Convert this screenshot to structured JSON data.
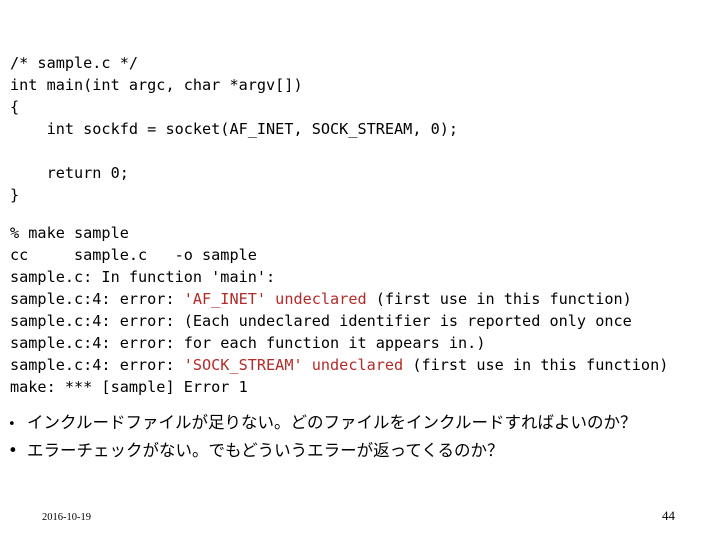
{
  "slide": {
    "background_color": "#ffffff",
    "error_color": "#b32b28",
    "text_color": "#000000"
  },
  "source_code": {
    "language": "c",
    "filename": "sample.c",
    "lines": [
      "/* sample.c */",
      "int main(int argc, char *argv[])",
      "{",
      "    int sockfd = socket(AF_INET, SOCK_STREAM, 0);",
      "",
      "    return 0;",
      "}"
    ]
  },
  "terminal": {
    "lines": [
      {
        "segments": [
          {
            "text": "% make sample",
            "error": false
          }
        ]
      },
      {
        "segments": [
          {
            "text": "cc     sample.c   -o sample",
            "error": false
          }
        ]
      },
      {
        "segments": [
          {
            "text": "sample.c: In function 'main':",
            "error": false
          }
        ]
      },
      {
        "segments": [
          {
            "text": "sample.c:4: error: ",
            "error": false
          },
          {
            "text": "'AF_INET' undeclared",
            "error": true
          },
          {
            "text": " (first use in this function)",
            "error": false
          }
        ]
      },
      {
        "segments": [
          {
            "text": "sample.c:4: error: (Each undeclared identifier is reported only once",
            "error": false
          }
        ]
      },
      {
        "segments": [
          {
            "text": "sample.c:4: error: for each function it appears in.)",
            "error": false
          }
        ]
      },
      {
        "segments": [
          {
            "text": "sample.c:4: error: ",
            "error": false
          },
          {
            "text": "'SOCK_STREAM' undeclared",
            "error": true
          },
          {
            "text": " (first use in this function)",
            "error": false
          }
        ]
      },
      {
        "segments": [
          {
            "text": "make: *** [sample] Error 1",
            "error": false
          }
        ]
      }
    ]
  },
  "notes": {
    "items": [
      {
        "bullet": "•",
        "text": "インクルードファイルが足りない。どのファイルをインクルードすればよいのか？"
      },
      {
        "bullet": "•",
        "text": "エラーチェックがない。でもどういうエラーが返ってくるのか？"
      }
    ]
  },
  "footer": {
    "date": "2016-10-19",
    "page_number": "44"
  }
}
